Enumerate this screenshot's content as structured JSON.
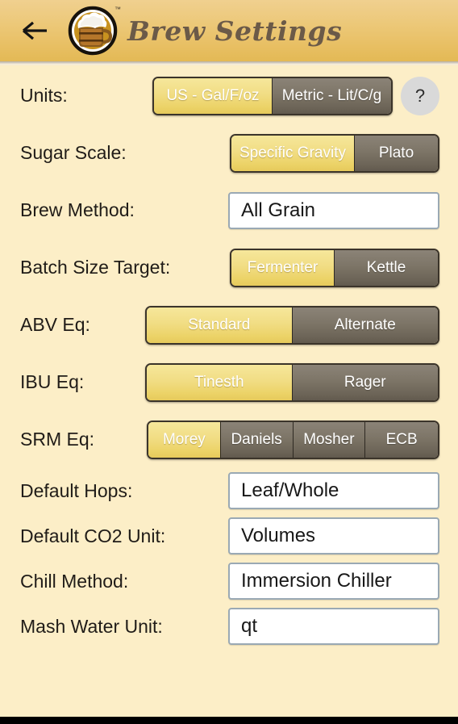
{
  "header": {
    "back_icon": "back-arrow-icon",
    "logo_icon": "beer-mug-logo-icon",
    "logo_tm": "™",
    "title": "Brew Settings"
  },
  "settings": {
    "units": {
      "label": "Units:",
      "options": [
        "US - Gal/F/oz",
        "Metric - Lit/C/g"
      ],
      "selected": "US - Gal/F/oz",
      "help_label": "?"
    },
    "sugar_scale": {
      "label": "Sugar Scale:",
      "options": [
        "Specific Gravity",
        "Plato"
      ],
      "selected": "Specific Gravity"
    },
    "brew_method": {
      "label": "Brew Method:",
      "value": "All Grain"
    },
    "batch_size_target": {
      "label": "Batch Size Target:",
      "options": [
        "Fermenter",
        "Kettle"
      ],
      "selected": "Fermenter"
    },
    "abv_eq": {
      "label": "ABV Eq:",
      "options": [
        "Standard",
        "Alternate"
      ],
      "selected": "Standard"
    },
    "ibu_eq": {
      "label": "IBU Eq:",
      "options": [
        "Tinesth",
        "Rager"
      ],
      "selected": "Tinesth"
    },
    "srm_eq": {
      "label": "SRM Eq:",
      "options": [
        "Morey",
        "Daniels",
        "Mosher",
        "ECB"
      ],
      "selected": "Morey"
    },
    "default_hops": {
      "label": "Default Hops:",
      "value": "Leaf/Whole"
    },
    "default_co2_unit": {
      "label": "Default CO2 Unit:",
      "value": "Volumes"
    },
    "chill_method": {
      "label": "Chill Method:",
      "value": "Immersion Chiller"
    },
    "mash_water_unit": {
      "label": "Mash Water Unit:",
      "value": "qt"
    }
  },
  "colors": {
    "page_background": "#fceec7",
    "header_gradient_top": "#f0d08f",
    "header_gradient_bottom": "#e3b955",
    "selected_segment": "#f1dd84",
    "unselected_segment": "#7d7567",
    "title_text": "#6b5a48",
    "label_text": "#201c18",
    "field_border": "#9aa9b4",
    "help_button": "#d9d9d9"
  }
}
